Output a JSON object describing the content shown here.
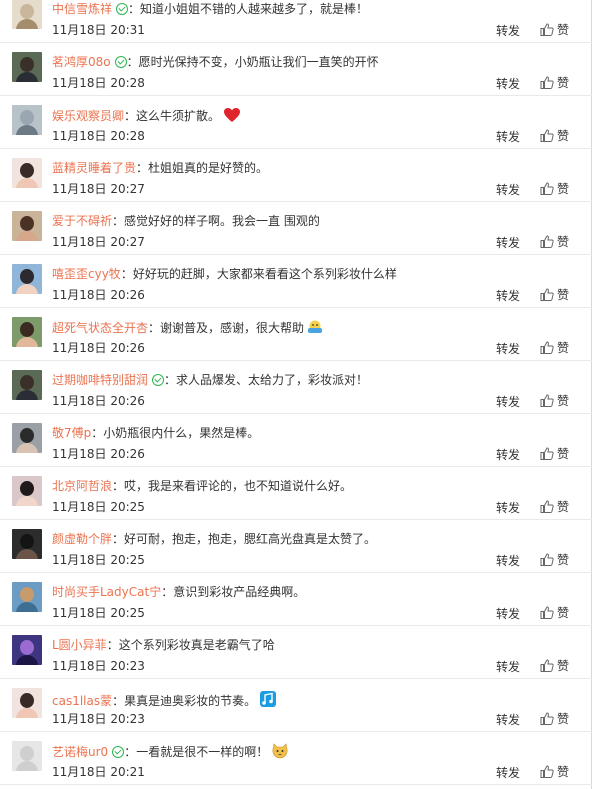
{
  "actions": {
    "repost_label": "转发",
    "like_label": "赞"
  },
  "comments": [
    {
      "user": "中信雪炼祥",
      "verified": true,
      "sep": "：",
      "text": "知道小姐姐不错的人越来越多了，就是棒！",
      "emoji": "",
      "time": "11月18日 20:31",
      "avatar": "cream"
    },
    {
      "user": "茗鸿厚08o",
      "verified": true,
      "sep": "：",
      "text": "愿时光保持不变，小奶瓶让我们一直笑的开怀",
      "emoji": "",
      "time": "11月18日 20:28",
      "avatar": "person-dark"
    },
    {
      "user": "娱乐观察员卿",
      "verified": false,
      "sep": "：",
      "text": "这么牛须扩散。",
      "emoji": "heart-emoji",
      "time": "11月18日 20:28",
      "avatar": "scene-gray"
    },
    {
      "user": "蓝精灵睡着了贵",
      "verified": false,
      "sep": "：",
      "text": "杜姐姐真的是好赞的。",
      "emoji": "",
      "time": "11月18日 20:27",
      "avatar": "person-light"
    },
    {
      "user": "爱于不碍祈",
      "verified": false,
      "sep": "：",
      "text": "感觉好好的样子啊。我会一直 围观的",
      "emoji": "",
      "time": "11月18日 20:27",
      "avatar": "person-brown"
    },
    {
      "user": "嘻歪歪cyy牧",
      "verified": false,
      "sep": "：",
      "text": "好好玩的赶脚，大家都来看看这个系列彩妆什么样",
      "emoji": "",
      "time": "11月18日 20:26",
      "avatar": "person-blue"
    },
    {
      "user": "超死气状态全开杏",
      "verified": false,
      "sep": "：",
      "text": "谢谢普及，感谢，很大帮助",
      "emoji": "lifebuoy-emoji",
      "time": "11月18日 20:26",
      "avatar": "person-green"
    },
    {
      "user": "过期咖啡特别甜润",
      "verified": true,
      "sep": "：",
      "text": "求人品爆发、太给力了，彩妆派对！",
      "emoji": "",
      "time": "11月18日 20:26",
      "avatar": "person-dark"
    },
    {
      "user": "敬7傅p",
      "verified": false,
      "sep": "：",
      "text": "小奶瓶很内什么，果然是棒。",
      "emoji": "",
      "time": "11月18日 20:26",
      "avatar": "person-gray"
    },
    {
      "user": "北京阿哲浪",
      "verified": false,
      "sep": "：",
      "text": "哎，我是来看评论的，也不知道说什么好。",
      "emoji": "",
      "time": "11月18日 20:25",
      "avatar": "person-pink"
    },
    {
      "user": "颜虚勒个胖",
      "verified": false,
      "sep": "：",
      "text": "好可耐，抱走，抱走，腮红高光盘真是太赞了。",
      "emoji": "",
      "time": "11月18日 20:25",
      "avatar": "person-black"
    },
    {
      "user": "时尚买手LadyCat宁",
      "verified": false,
      "sep": "：",
      "text": "意识到彩妆产品经典啊。",
      "emoji": "",
      "time": "11月18日 20:25",
      "avatar": "scene-blue"
    },
    {
      "user": "L圆小异菲",
      "verified": false,
      "sep": "：",
      "text": "这个系列彩妆真是老霸气了哈",
      "emoji": "",
      "time": "11月18日 20:23",
      "avatar": "scene-purple"
    },
    {
      "user": "cas1llas蒙",
      "verified": false,
      "sep": "：",
      "text": "果真是迪奥彩妆的节奏。",
      "emoji": "music-emoji",
      "time": "11月18日 20:23",
      "avatar": "person-light"
    },
    {
      "user": "艺诺梅ur0",
      "verified": true,
      "sep": "：",
      "text": "一看就是很不一样的啊！",
      "emoji": "cat-emoji",
      "time": "11月18日 20:21",
      "avatar": "default-gray"
    }
  ],
  "colors": {
    "username": "#eb7350",
    "text": "#333333",
    "verified": "#2db450"
  }
}
